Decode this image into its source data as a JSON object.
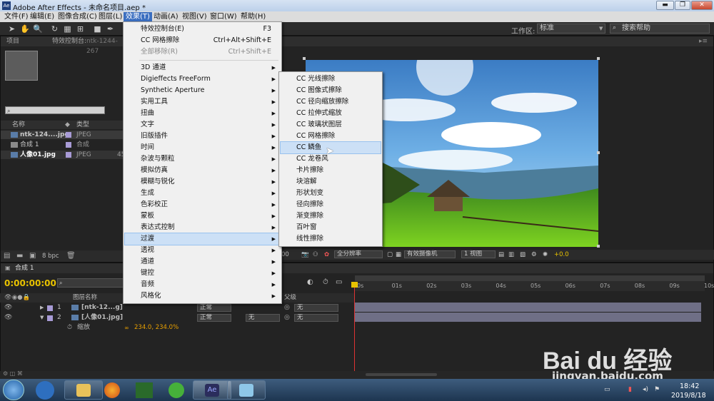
{
  "window": {
    "title": "Adobe After Effects - 未命名项目.aep *",
    "icon": "Ae"
  },
  "menubar": {
    "items": [
      "文件(F)",
      "编辑(E)",
      "图像合成(C)",
      "图层(L)",
      "效果(T)",
      "动画(A)",
      "视图(V)",
      "窗口(W)",
      "帮助(H)"
    ],
    "active": "效果(T)"
  },
  "toolbar": {
    "workspace_label": "工作区:",
    "workspace_value": "标准",
    "search_placeholder": "搜索帮助"
  },
  "project_panel": {
    "tab_project": "项目",
    "tab_effects": "特效控制台:",
    "tab_effects_sub": "ntk-1244-267",
    "search_placeholder": "",
    "columns": {
      "name": "名称",
      "type": "类型"
    },
    "rows": [
      {
        "name": "ntk-124....jpg",
        "type": "JPEG",
        "swatch": "#a89bd6"
      },
      {
        "name": "合成 1",
        "type": "合成",
        "swatch": "#a89bd6"
      },
      {
        "name": "人像01.jpg",
        "type": "JPEG",
        "size": "45",
        "swatch": "#a89bd6"
      }
    ],
    "bpc": "8 bpc"
  },
  "effects_menu": {
    "top": [
      {
        "label": "特效控制台(E)",
        "shortcut": "F3"
      },
      {
        "label": "CC 网格擦除",
        "shortcut": "Ctrl+Alt+Shift+E"
      },
      {
        "label": "全部移除(R)",
        "shortcut": "Ctrl+Shift+E",
        "disabled": true
      }
    ],
    "categories": [
      "3D 通道",
      "Digieffects FreeForm",
      "Synthetic Aperture",
      "实用工具",
      "扭曲",
      "文字",
      "旧版插件",
      "时间",
      "杂波与颗粒",
      "模拟仿真",
      "模糊与锐化",
      "生成",
      "色彩校正",
      "蒙板",
      "表达式控制",
      "过渡",
      "透视",
      "通道",
      "键控",
      "音频",
      "风格化"
    ],
    "highlighted": "过渡"
  },
  "transition_submenu": {
    "items": [
      "CC 光线擦除",
      "CC 图像式擦除",
      "CC 径向缩放擦除",
      "CC 拉伸式缩放",
      "CC 玻璃状图层",
      "CC 网格擦除",
      "CC 鳞鱼",
      "CC 龙卷风",
      "卡片擦除",
      "块溶解",
      "形状划变",
      "径向擦除",
      "渐变擦除",
      "百叶窗",
      "线性擦除"
    ],
    "highlighted": "CC 鳞鱼"
  },
  "viewer": {
    "zoom": "全分辨率",
    "camera": "有效摄像机",
    "views": "1 视图",
    "timecode_frag": "00",
    "exposure": "+0.0"
  },
  "timeline": {
    "tab": "合成 1",
    "timecode": "0:00:00:00",
    "header": {
      "source": "图层名称",
      "parent": "父级"
    },
    "layers": [
      {
        "num": "1",
        "name": "[ntk-12...g]",
        "mode": "正常",
        "trkmat": "",
        "parent": "无"
      },
      {
        "num": "2",
        "name": "[人像01.jpg]",
        "mode": "正常",
        "trkmat": "无",
        "parent": "无"
      }
    ],
    "property": {
      "name": "缩放",
      "value": "234.0, 234.0%"
    },
    "ruler": [
      "0s",
      "01s",
      "02s",
      "03s",
      "04s",
      "05s",
      "06s",
      "07s",
      "08s",
      "09s",
      "10s"
    ]
  },
  "taskbar": {
    "time": "18:42",
    "date": "2019/8/18"
  },
  "watermark": {
    "brand": "Bai du 经验",
    "url": "jingyan.baidu.com"
  },
  "colors": {
    "menu_highlight": "#cce0f6",
    "menubar_active": "#3a6ec0",
    "playhead": "#d33",
    "layer_bar": "#6f6f86"
  }
}
